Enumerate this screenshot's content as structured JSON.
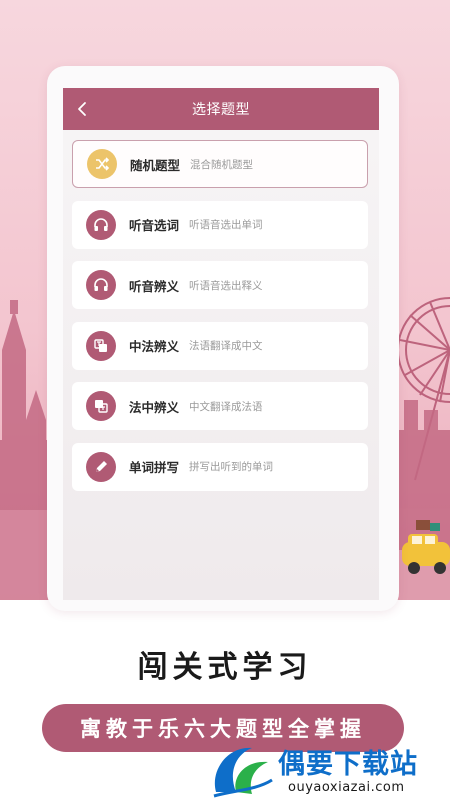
{
  "header": {
    "title": "选择题型"
  },
  "items": [
    {
      "label": "随机题型",
      "desc": "混合随机题型",
      "icon": "shuffle-icon",
      "selected": true
    },
    {
      "label": "听音选词",
      "desc": "听语音选出单词",
      "icon": "headphones-icon",
      "selected": false
    },
    {
      "label": "听音辨义",
      "desc": "听语音选出释义",
      "icon": "headphones-icon",
      "selected": false
    },
    {
      "label": "中法辨义",
      "desc": "法语翻译成中文",
      "icon": "translate-icon",
      "selected": false
    },
    {
      "label": "法中辨义",
      "desc": "中文翻译成法语",
      "icon": "translate-icon",
      "selected": false
    },
    {
      "label": "单词拼写",
      "desc": "拼写出听到的单词",
      "icon": "pencil-icon",
      "selected": false
    }
  ],
  "promo": {
    "slogan": "闯关式学习",
    "banner": "寓教于乐六大题型全掌握"
  },
  "watermark": {
    "title": "偶要下载站",
    "url": "ouyaoxiazai.com"
  },
  "colors": {
    "accent": "#b05a74",
    "gold": "#ecc46a",
    "background_pink": "#f3c5cf"
  }
}
